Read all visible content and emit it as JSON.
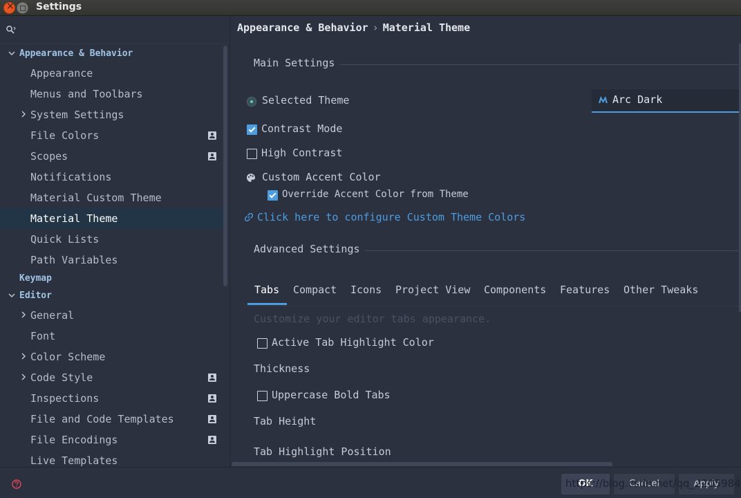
{
  "window": {
    "title": "Settings"
  },
  "breadcrumb": {
    "parent": "Appearance & Behavior",
    "separator": "›",
    "current": "Material Theme"
  },
  "sidebar": {
    "items": [
      {
        "label": "Appearance & Behavior",
        "kind": "group",
        "expanded": true
      },
      {
        "label": "Appearance"
      },
      {
        "label": "Menus and Toolbars"
      },
      {
        "label": "System Settings",
        "arrow": true
      },
      {
        "label": "File Colors",
        "badge": true
      },
      {
        "label": "Scopes",
        "badge": true
      },
      {
        "label": "Notifications"
      },
      {
        "label": "Material Custom Theme"
      },
      {
        "label": "Material Theme",
        "selected": true
      },
      {
        "label": "Quick Lists"
      },
      {
        "label": "Path Variables"
      },
      {
        "label": "Keymap",
        "kind": "group"
      },
      {
        "label": "Editor",
        "kind": "group",
        "expanded": true
      },
      {
        "label": "General",
        "arrow": true
      },
      {
        "label": "Font"
      },
      {
        "label": "Color Scheme",
        "arrow": true
      },
      {
        "label": "Code Style",
        "arrow": true,
        "badge": true
      },
      {
        "label": "Inspections",
        "badge": true
      },
      {
        "label": "File and Code Templates",
        "badge": true
      },
      {
        "label": "File Encodings",
        "badge": true
      },
      {
        "label": "Live Templates"
      }
    ]
  },
  "main": {
    "main_settings_title": "Main Settings",
    "selected_theme_label": "Selected Theme",
    "selected_theme_value": "Arc Dark",
    "contrast_mode": {
      "label": "Contrast Mode",
      "checked": true
    },
    "high_contrast": {
      "label": "High Contrast",
      "checked": false
    },
    "custom_accent_label": "Custom Accent Color",
    "override_accent": {
      "label": "Override Accent Color from Theme",
      "checked": true
    },
    "configure_link": "Click here to configure Custom Theme Colors",
    "advanced_settings_title": "Advanced Settings",
    "tabs": [
      "Tabs",
      "Compact",
      "Icons",
      "Project View",
      "Components",
      "Features",
      "Other Tweaks"
    ],
    "active_tab": "Tabs",
    "tabs_hint": "Customize your editor tabs appearance.",
    "active_tab_highlight": {
      "label": "Active Tab Highlight Color",
      "checked": false
    },
    "thickness_label": "Thickness",
    "uppercase_bold": {
      "label": "Uppercase Bold Tabs",
      "checked": false
    },
    "tab_height_label": "Tab Height",
    "tab_highlight_position_label": "Tab Highlight Position"
  },
  "footer": {
    "ok_label": "OK",
    "cancel_label": "Cancel",
    "apply_label": "Apply",
    "watermark": "https://blog.csdn.net/qq_22059843"
  },
  "colors": {
    "accent": "#4d9de0",
    "background": "#2c3140",
    "selection": "#213547",
    "link": "#4d9de0"
  }
}
